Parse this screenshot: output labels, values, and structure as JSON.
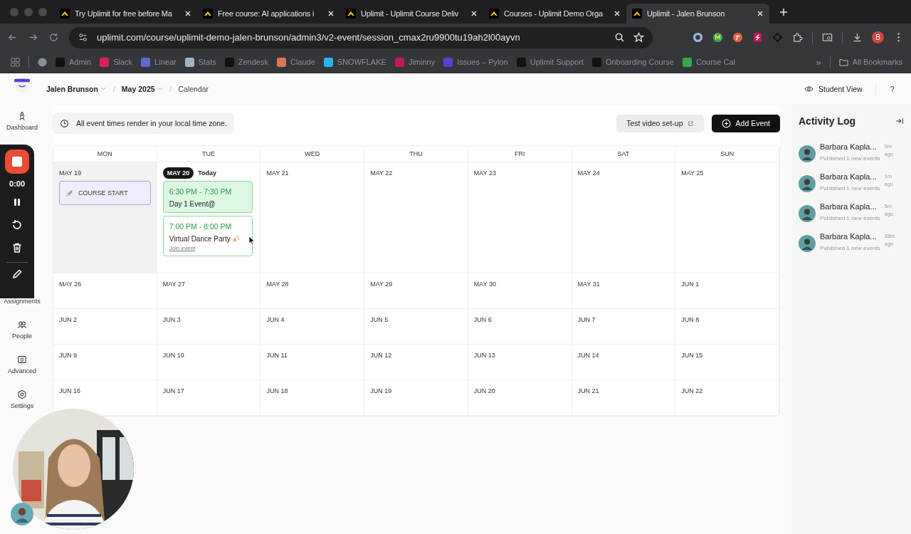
{
  "browser": {
    "tabs": [
      {
        "title": "Try Uplimit for free before Ma",
        "selected": false
      },
      {
        "title": "Free course: AI applications i",
        "selected": false
      },
      {
        "title": "Uplimit - Uplimit Course Deliv",
        "selected": false
      },
      {
        "title": "Courses - Uplimit Demo Orga",
        "selected": false
      },
      {
        "title": "Uplimit - Jalen Brunson",
        "selected": true
      }
    ],
    "url": "uplimit.com/course/uplimit-demo-jalen-brunson/admin3/v2-event/session_cmax2ru9900tu19ah2l00ayvn",
    "profile": "B",
    "bookmarks": [
      {
        "color": "#8a8f96"
      },
      {
        "label": "Admin",
        "color": "#111111"
      },
      {
        "label": "Slack",
        "color": "#e01e5a"
      },
      {
        "label": "Linear",
        "color": "#5e6ad2"
      },
      {
        "label": "Stats",
        "color": "#9fb4c0"
      },
      {
        "label": "Zendesk",
        "color": "#111111"
      },
      {
        "label": "Claude",
        "color": "#d97757"
      },
      {
        "label": "SNOWFLAKE",
        "color": "#29b5e8"
      },
      {
        "label": "Jiminny",
        "color": "#c2185b"
      },
      {
        "label": "Issues – Pylon",
        "color": "#5b3fd6"
      },
      {
        "label": "Uplimit Support",
        "color": "#111111"
      },
      {
        "label": "Onboarding Course",
        "color": "#111111"
      },
      {
        "label": "Course Cal",
        "color": "#34a853"
      }
    ],
    "more": "»",
    "all_bookmarks": "All Bookmarks"
  },
  "breadcrumb_separator": "/",
  "breadcrumbs": [
    {
      "label": "Jalen Brunson",
      "menu": true
    },
    {
      "label": "May 2025",
      "menu": true
    },
    {
      "label": "Calendar",
      "menu": false
    }
  ],
  "student_view": "Student View",
  "help": "?",
  "nav": [
    {
      "kind": "dashboard",
      "label": "Dashboard"
    },
    {
      "kind": "assignments",
      "label": "Assignments"
    },
    {
      "kind": "people",
      "label": "People"
    },
    {
      "kind": "advanced",
      "label": "Advanced"
    },
    {
      "kind": "settings",
      "label": "Settings"
    }
  ],
  "recorder": {
    "time": "0:00"
  },
  "notice": "All event times render in your local time zone.",
  "test_video": "Test video set-up",
  "add_event": "Add Event",
  "calendar": {
    "weekdays": [
      "MON",
      "TUE",
      "WED",
      "THU",
      "FRI",
      "SAT",
      "SUN"
    ],
    "today_label": "Today",
    "weeks": [
      {
        "days": [
          {
            "date": "MAY 19",
            "past": true,
            "today": false,
            "events": [
              {
                "kind": "banner",
                "title": "COURSE START"
              }
            ]
          },
          {
            "date": "MAY 20",
            "past": false,
            "today": true,
            "events": [
              {
                "kind": "session",
                "time": "6:30 PM - 7:30 PM",
                "title": "Day 1 Event@",
                "highlighted": true
              },
              {
                "kind": "session",
                "time": "7:00 PM - 8:00 PM",
                "title": "Virtual Dance Party",
                "highlighted": false,
                "party_icon": true,
                "link": "Join event"
              }
            ]
          },
          {
            "date": "MAY 21",
            "past": false,
            "today": false
          },
          {
            "date": "MAY 22",
            "past": false,
            "today": false
          },
          {
            "date": "MAY 23",
            "past": false,
            "today": false
          },
          {
            "date": "MAY 24",
            "past": false,
            "today": false
          },
          {
            "date": "MAY 25",
            "past": false,
            "today": false
          }
        ]
      },
      {
        "days": [
          {
            "date": "MAY 26",
            "past": false,
            "today": false
          },
          {
            "date": "MAY 27",
            "past": false,
            "today": false
          },
          {
            "date": "MAY 28",
            "past": false,
            "today": false
          },
          {
            "date": "MAY 29",
            "past": false,
            "today": false
          },
          {
            "date": "MAY 30",
            "past": false,
            "today": false
          },
          {
            "date": "MAY 31",
            "past": false,
            "today": false
          },
          {
            "date": "JUN 1",
            "past": false,
            "today": false
          }
        ]
      },
      {
        "days": [
          {
            "date": "JUN 2",
            "past": false,
            "today": false
          },
          {
            "date": "JUN 3",
            "past": false,
            "today": false
          },
          {
            "date": "JUN 4",
            "past": false,
            "today": false
          },
          {
            "date": "JUN 5",
            "past": false,
            "today": false
          },
          {
            "date": "JUN 6",
            "past": false,
            "today": false
          },
          {
            "date": "JUN 7",
            "past": false,
            "today": false
          },
          {
            "date": "JUN 8",
            "past": false,
            "today": false
          }
        ]
      },
      {
        "days": [
          {
            "date": "JUN 9",
            "past": false,
            "today": false
          },
          {
            "date": "JUN 10",
            "past": false,
            "today": false
          },
          {
            "date": "JUN 11",
            "past": false,
            "today": false
          },
          {
            "date": "JUN 12",
            "past": false,
            "today": false
          },
          {
            "date": "JUN 13",
            "past": false,
            "today": false
          },
          {
            "date": "JUN 14",
            "past": false,
            "today": false
          },
          {
            "date": "JUN 15",
            "past": false,
            "today": false
          }
        ]
      },
      {
        "days": [
          {
            "date": "JUN 16",
            "past": false,
            "today": false
          },
          {
            "date": "JUN 17",
            "past": false,
            "today": false
          },
          {
            "date": "JUN 18",
            "past": false,
            "today": false
          },
          {
            "date": "JUN 19",
            "past": false,
            "today": false
          },
          {
            "date": "JUN 20",
            "past": false,
            "today": false
          },
          {
            "date": "JUN 21",
            "past": false,
            "today": false
          },
          {
            "date": "JUN 22",
            "past": false,
            "today": false
          }
        ]
      }
    ]
  },
  "activity_log": {
    "title": "Activity Log",
    "entries": [
      {
        "name": "Barbara Kapla...",
        "action": "Published 1 new events",
        "time": "0m ago"
      },
      {
        "name": "Barbara Kapla...",
        "action": "Published 1 new events",
        "time": "1m ago"
      },
      {
        "name": "Barbara Kapla...",
        "action": "Published 1 new events",
        "time": "5m ago"
      },
      {
        "name": "Barbara Kapla...",
        "action": "Published 1 new events",
        "time": "38m ago"
      }
    ]
  }
}
